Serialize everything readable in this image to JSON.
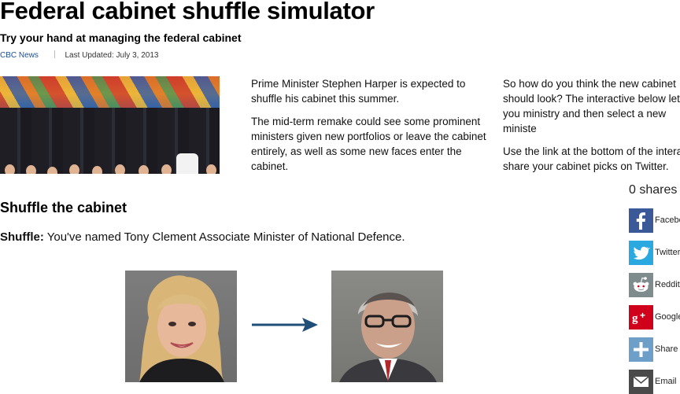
{
  "article": {
    "title": "Federal cabinet shuffle simulator",
    "subtitle": "Try your hand at managing the federal cabinet",
    "source": "CBC News",
    "updated": "Last Updated: July 3, 2013"
  },
  "intro": {
    "col1": [
      "Prime Minister Stephen Harper is expected to shuffle his cabinet this summer.",
      "The mid-term remake could see some prominent ministers given new portfolios or leave the cabinet entirely, as well as some new faces enter the cabinet."
    ],
    "col2": [
      "So how do you think the new cabinet should look? The interactive below lets you ministry and then select a new ministe",
      "Use the link at the bottom of the intera share your cabinet picks on Twitter."
    ]
  },
  "section": {
    "heading": "Shuffle the cabinet"
  },
  "shuffle": {
    "label": "Shuffle:",
    "message": "You've named Tony Clement Associate Minister of National Defence."
  },
  "share": {
    "count_text": "0 shares",
    "items": [
      {
        "label": "Facebook",
        "icon": "facebook-icon",
        "color": "#3b5998"
      },
      {
        "label": "Twitter",
        "icon": "twitter-icon",
        "color": "#2aa9e0"
      },
      {
        "label": "Reddit",
        "icon": "reddit-icon",
        "color": "#7f8c8d"
      },
      {
        "label": "Google",
        "icon": "google-plus-icon",
        "color": "#d0021b"
      },
      {
        "label": "Share",
        "icon": "plus-icon",
        "color": "#6d9fc9"
      },
      {
        "label": "Email",
        "icon": "email-icon",
        "color": "#4a4a4a"
      }
    ]
  },
  "colors": {
    "arrow": "#1f4e79",
    "link": "#1a4f9c"
  }
}
